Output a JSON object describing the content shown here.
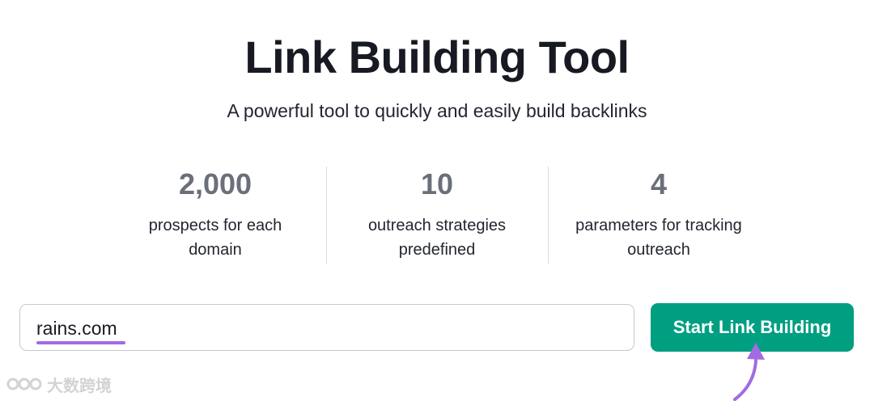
{
  "header": {
    "title": "Link Building Tool",
    "subtitle": "A powerful tool to quickly and easily build backlinks"
  },
  "stats": [
    {
      "number": "2,000",
      "label": "prospects for each domain"
    },
    {
      "number": "10",
      "label": "outreach strategies predefined"
    },
    {
      "number": "4",
      "label": "parameters for tracking outreach"
    }
  ],
  "form": {
    "domain_value": "rains.com",
    "submit_label": "Start Link Building"
  },
  "colors": {
    "accent": "#009f81",
    "highlight": "#a36be0",
    "stat_number": "#6b6f7a"
  },
  "watermark": {
    "text": "大数跨境"
  }
}
